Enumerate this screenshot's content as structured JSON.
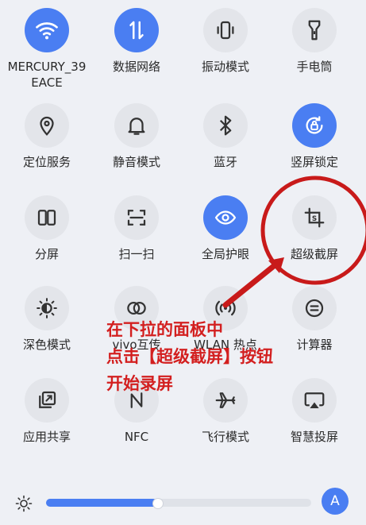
{
  "colors": {
    "accent": "#4a7ef2",
    "tile_bg": "#e3e5ea",
    "annotation": "#d31f1f"
  },
  "tiles": [
    {
      "label": "MERCURY_39EACE",
      "icon": "wifi-icon",
      "active": true
    },
    {
      "label": "数据网络",
      "icon": "mobile-data-icon",
      "active": true
    },
    {
      "label": "振动模式",
      "icon": "vibrate-icon",
      "active": false
    },
    {
      "label": "手电筒",
      "icon": "flashlight-icon",
      "active": false
    },
    {
      "label": "定位服务",
      "icon": "location-icon",
      "active": false
    },
    {
      "label": "静音模式",
      "icon": "bell-icon",
      "active": false
    },
    {
      "label": "蓝牙",
      "icon": "bluetooth-icon",
      "active": false
    },
    {
      "label": "竖屏锁定",
      "icon": "rotation-lock-icon",
      "active": true
    },
    {
      "label": "分屏",
      "icon": "split-screen-icon",
      "active": false
    },
    {
      "label": "扫一扫",
      "icon": "scan-icon",
      "active": false
    },
    {
      "label": "全局护眼",
      "icon": "eye-icon",
      "active": true
    },
    {
      "label": "超级截屏",
      "icon": "super-screenshot-icon",
      "active": false
    },
    {
      "label": "深色模式",
      "icon": "dark-mode-icon",
      "active": false
    },
    {
      "label": "vivo互传",
      "icon": "vivo-share-icon",
      "active": false
    },
    {
      "label": "WLAN 热点",
      "icon": "hotspot-icon",
      "active": false
    },
    {
      "label": "计算器",
      "icon": "calculator-icon",
      "active": false
    },
    {
      "label": "应用共享",
      "icon": "app-share-icon",
      "active": false
    },
    {
      "label": "NFC",
      "icon": "nfc-icon",
      "active": false
    },
    {
      "label": "飞行模式",
      "icon": "airplane-icon",
      "active": false
    },
    {
      "label": "智慧投屏",
      "icon": "screen-cast-icon",
      "active": false
    }
  ],
  "brightness": {
    "level": 0.42,
    "auto_label": "A"
  },
  "annotation": {
    "lines": [
      "在下拉的面板中",
      "点击【超级截屏】按钮",
      "开始录屏"
    ]
  }
}
